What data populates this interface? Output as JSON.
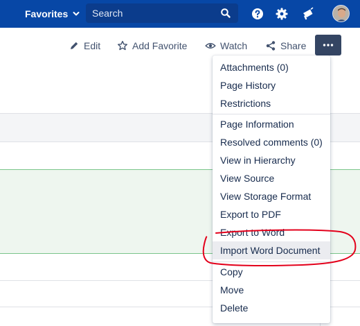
{
  "topbar": {
    "favorites_label": "Favorites",
    "search_placeholder": "Search",
    "bg_color": "#0747a6"
  },
  "actions": {
    "edit": "Edit",
    "add_favorite": "Add Favorite",
    "watch": "Watch",
    "share": "Share"
  },
  "menu": {
    "items": [
      "Attachments (0)",
      "Page History",
      "Restrictions",
      "Page Information",
      "Resolved comments (0)",
      "View in Hierarchy",
      "View Source",
      "View Storage Format",
      "Export to PDF",
      "Export to Word",
      "Import Word Document",
      "Copy",
      "Move",
      "Delete"
    ],
    "highlighted": "Import Word Document"
  },
  "colors": {
    "annotation": "#e3001b",
    "menu_highlight": "#ebecf0",
    "more_button": "#344563"
  }
}
